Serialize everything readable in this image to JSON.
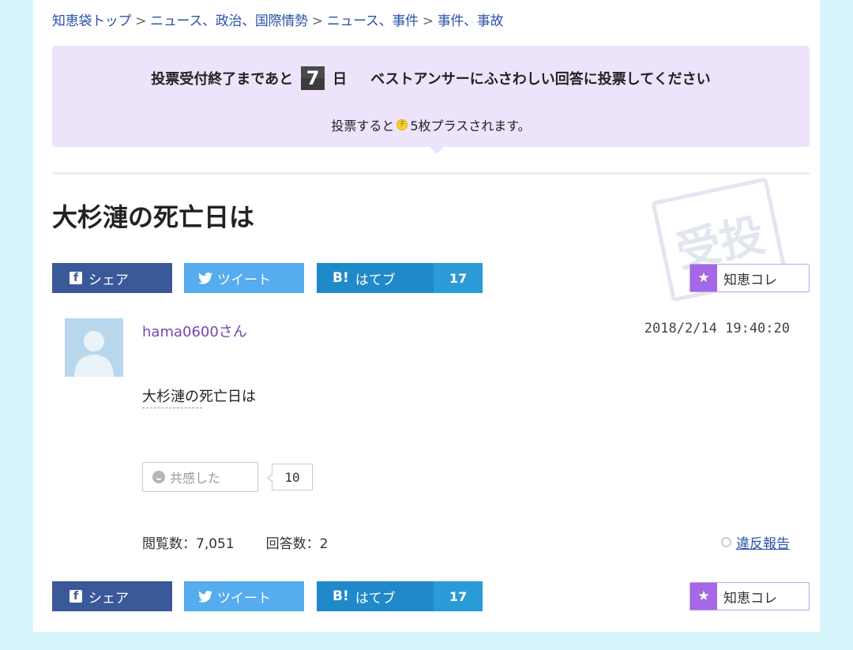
{
  "breadcrumb": {
    "items": [
      "知恵袋トップ",
      "ニュース、政治、国際情勢",
      "ニュース、事件",
      "事件、事故"
    ],
    "separator": ">"
  },
  "vote_notice": {
    "prefix": "投票受付終了まであと",
    "days": "7",
    "day_unit": "日",
    "message": "ベストアンサーにふさわしい回答に投票してください",
    "reward_prefix": "投票すると",
    "coin_symbol": "チ",
    "reward_suffix": "5枚プラスされます。"
  },
  "question": {
    "title": "大杉漣の死亡日は",
    "stamp_text": "受投",
    "author": "hama0600さん",
    "posted_at": "2018/2/14 19:40:20",
    "body": "大杉漣の死亡日は"
  },
  "share": {
    "facebook_label": "シェア",
    "facebook_logo": "f",
    "twitter_label": "ツイート",
    "hatena_logo": "B!",
    "hatena_label": "はてブ",
    "hatena_count": "17",
    "chie_label": "知恵コレ",
    "chie_star": "★"
  },
  "empathy": {
    "label": "共感した",
    "count": "10"
  },
  "stats": {
    "views": "閲覧数：7,051",
    "answers": "回答数：2"
  },
  "report": {
    "label": "違反報告"
  },
  "colors": {
    "background": "#d6f6fb",
    "notice_bg": "#ede3fb",
    "facebook": "#3b5998",
    "twitter": "#55acee",
    "hatena": "#1f89c9",
    "chie_accent": "#a567e5",
    "username": "#7b45b1",
    "link": "#2b53a6"
  }
}
